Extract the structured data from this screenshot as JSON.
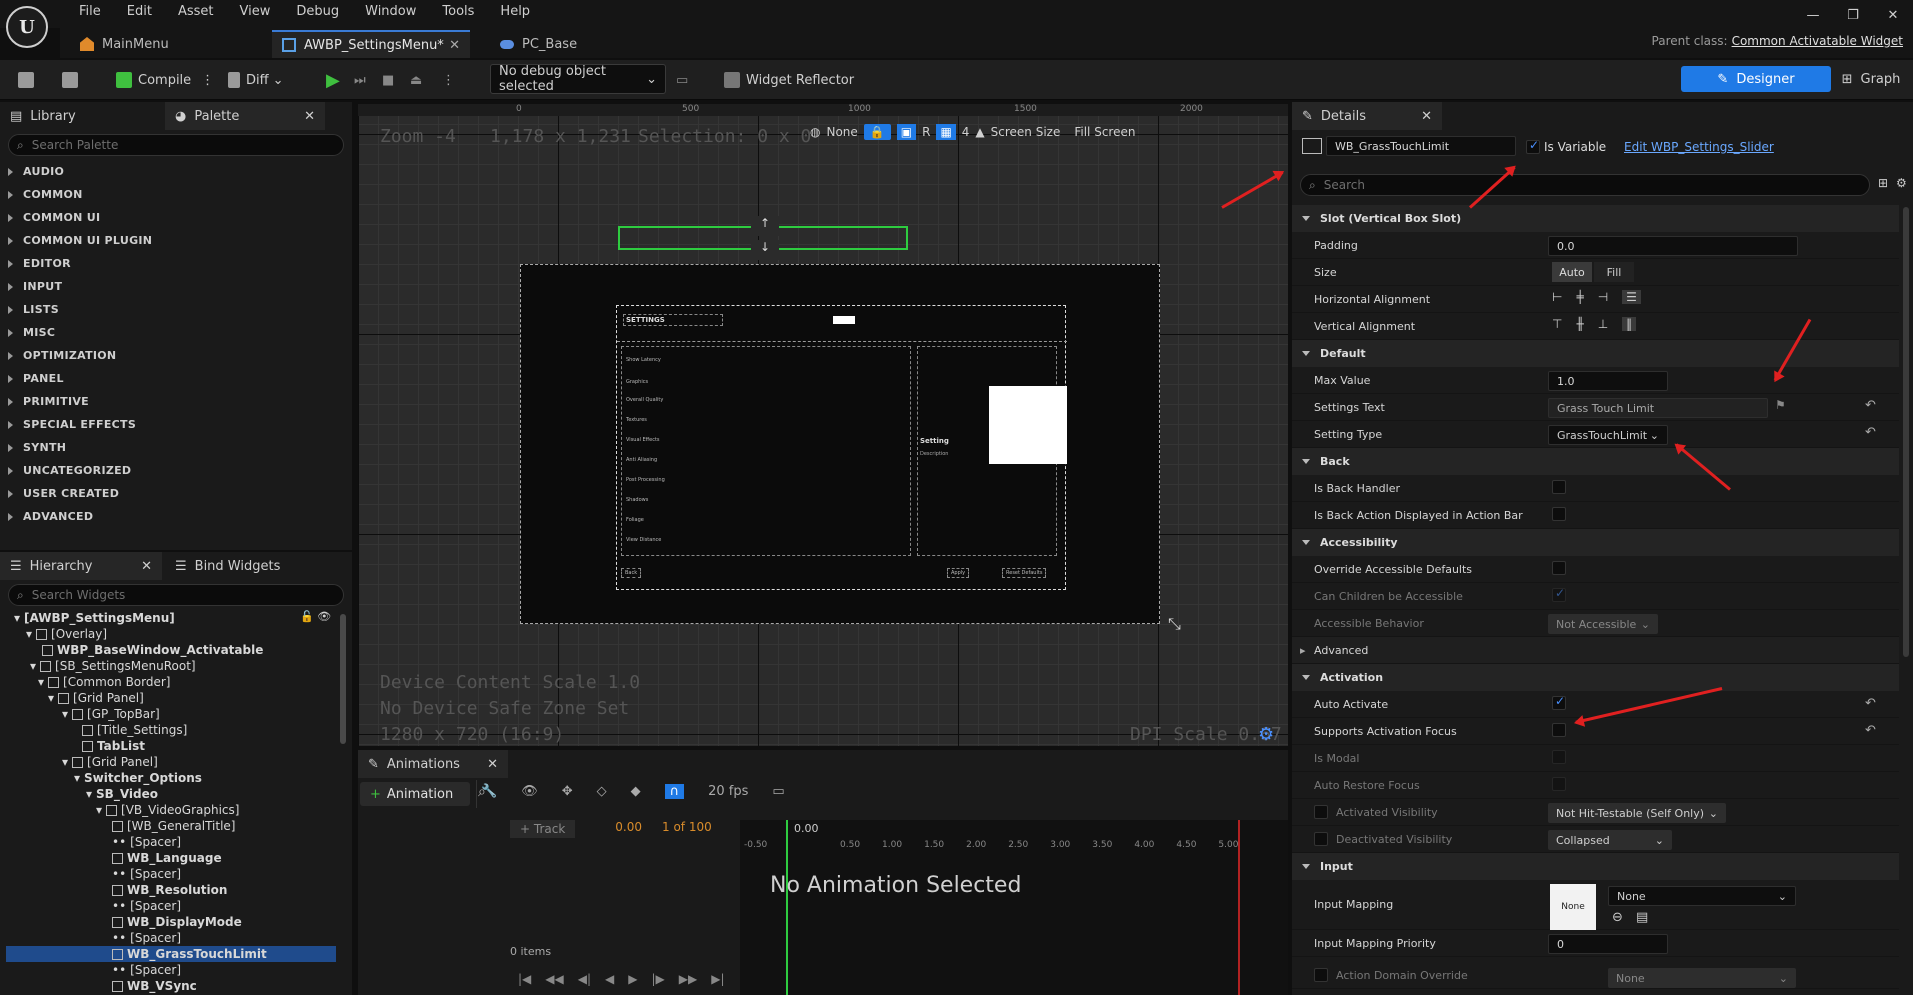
{
  "menu": [
    "File",
    "Edit",
    "Asset",
    "View",
    "Debug",
    "Window",
    "Tools",
    "Help"
  ],
  "tabs": {
    "main": "MainMenu",
    "active": "AWBP_SettingsMenu*",
    "pc": "PC_Base"
  },
  "parent_class": {
    "label": "Parent class:",
    "value": "Common Activatable Widget"
  },
  "toolbar": {
    "compile": "Compile",
    "diff": "Diff",
    "debug_select": "No debug object selected",
    "widget_reflector": "Widget Reflector",
    "designer": "Designer",
    "graph": "Graph"
  },
  "library": {
    "tab_library": "Library",
    "tab_palette": "Palette",
    "search_placeholder": "Search Palette",
    "categories": [
      "AUDIO",
      "COMMON",
      "COMMON UI",
      "COMMON UI PLUGIN",
      "EDITOR",
      "INPUT",
      "LISTS",
      "MISC",
      "OPTIMIZATION",
      "PANEL",
      "PRIMITIVE",
      "SPECIAL EFFECTS",
      "SYNTH",
      "UNCATEGORIZED",
      "USER CREATED",
      "ADVANCED"
    ]
  },
  "hierarchy": {
    "tab": "Hierarchy",
    "bind_tab": "Bind Widgets",
    "search_placeholder": "Search Widgets",
    "nodes": [
      "[AWBP_SettingsMenu]",
      "[Overlay]",
      "WBP_BaseWindow_Activatable",
      "[SB_SettingsMenuRoot]",
      "[Common Border]",
      "[Grid Panel]",
      "[GP_TopBar]",
      "[Title_Settings]",
      "TabList",
      "[Grid Panel]",
      "Switcher_Options",
      "SB_Video",
      "[VB_VideoGraphics]",
      "[WB_GeneralTitle]",
      "[Spacer]",
      "WB_Language",
      "[Spacer]",
      "WB_Resolution",
      "[Spacer]",
      "WB_DisplayMode",
      "[Spacer]",
      "WB_GrassTouchLimit",
      "[Spacer]",
      "WB_VSync"
    ]
  },
  "viewport": {
    "zoom": "Zoom -4",
    "res": "1,178 x 1,231",
    "selection": "Selection: 0 x 0",
    "none": "None",
    "r": "R",
    "grid": "4",
    "screen_size": "Screen Size",
    "fill_screen": "Fill Screen",
    "device_scale": "Device Content Scale 1.0",
    "safe_zone": "No Device Safe Zone Set",
    "resolution": "1280 x 720 (16:9)",
    "dpi": "DPI Scale 0.67",
    "ruler": [
      "0",
      "500",
      "1000",
      "1500",
      "2000"
    ],
    "preview": {
      "title": "SETTINGS",
      "setting": "Setting",
      "description": "Description",
      "back": "Back",
      "apply": "Apply",
      "reset": "Reset Defaults",
      "rows": [
        "Show Latency",
        "Graphics",
        "Overall Quality",
        "Textures",
        "Visual Effects",
        "Anti Aliasing",
        "Post Processing",
        "Shadows",
        "Foliage",
        "View Distance"
      ]
    }
  },
  "animations": {
    "tab": "Animations",
    "add": "Animation",
    "track": "Track",
    "time": "0.00",
    "frames": "1 of 100",
    "fps": "20 fps",
    "items": "0 items",
    "empty": "No Animation Selected",
    "ticks": [
      "0.50",
      "1.00",
      "1.50",
      "2.00",
      "2.50",
      "3.00",
      "3.50",
      "4.00",
      "4.50",
      "5.00"
    ],
    "start": "-0.50",
    "zero": "0.00"
  },
  "details": {
    "tab": "Details",
    "widget_name": "WB_GrassTouchLimit",
    "is_variable": "Is Variable",
    "edit_link": "Edit WBP_Settings_Slider",
    "search_placeholder": "Search",
    "slot_section": "Slot (Vertical Box Slot)",
    "padding": {
      "label": "Padding",
      "value": "0.0"
    },
    "size": {
      "label": "Size",
      "auto": "Auto",
      "fill": "Fill"
    },
    "halign": "Horizontal Alignment",
    "valign": "Vertical Alignment",
    "default_section": "Default",
    "max_value": {
      "label": "Max Value",
      "value": "1.0"
    },
    "settings_text": {
      "label": "Settings Text",
      "value": "Grass Touch Limit"
    },
    "setting_type": {
      "label": "Setting Type",
      "value": "GrassTouchLimit"
    },
    "back_section": "Back",
    "is_back_handler": "Is Back Handler",
    "back_action": "Is Back Action Displayed in Action Bar",
    "access_section": "Accessibility",
    "override_access": "Override Accessible Defaults",
    "children_access": "Can Children be Accessible",
    "access_behavior": {
      "label": "Accessible Behavior",
      "value": "Not Accessible"
    },
    "advanced": "Advanced",
    "activation_section": "Activation",
    "auto_activate": "Auto Activate",
    "supports_focus": "Supports Activation Focus",
    "is_modal": "Is Modal",
    "auto_restore": "Auto Restore Focus",
    "activated_vis": {
      "label": "Activated Visibility",
      "value": "Not Hit-Testable (Self Only)"
    },
    "deactivated_vis": {
      "label": "Deactivated Visibility",
      "value": "Collapsed"
    },
    "input_section": "Input",
    "input_mapping": {
      "label": "Input Mapping",
      "value": "None",
      "thumb": "None"
    },
    "input_priority": {
      "label": "Input Mapping Priority",
      "value": "0"
    },
    "action_domain": {
      "label": "Action Domain Override",
      "value": "None"
    }
  },
  "colors": {
    "accent": "#1f7ae6",
    "selection": "#1f4b8c",
    "green": "#2ecc40",
    "arrow": "#e02020"
  }
}
